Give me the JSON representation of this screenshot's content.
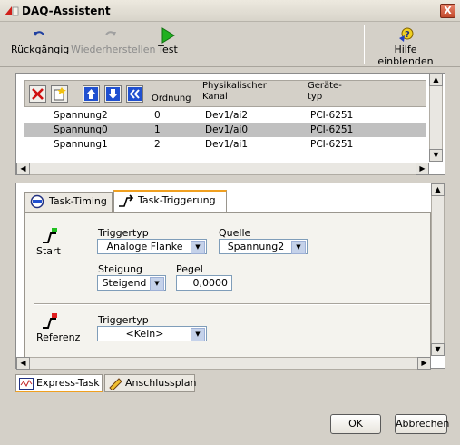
{
  "window": {
    "title": "DAQ-Assistent",
    "close_glyph": "X"
  },
  "toolbar": {
    "undo_label": "Rückgängig",
    "redo_label": "Wiederherstellen",
    "test_label": "Test",
    "help_label": "Hilfe einblenden"
  },
  "channels": {
    "columns": [
      "Ordnung",
      "Physikalischer Kanal",
      "Geräte- typ"
    ],
    "rows": [
      {
        "name": "Spannung2",
        "order": "0",
        "channel": "Dev1/ai2",
        "device": "PCI-6251",
        "selected": false
      },
      {
        "name": "Spannung0",
        "order": "1",
        "channel": "Dev1/ai0",
        "device": "PCI-6251",
        "selected": true
      },
      {
        "name": "Spannung1",
        "order": "2",
        "channel": "Dev1/ai1",
        "device": "PCI-6251",
        "selected": false
      }
    ]
  },
  "tabs": [
    {
      "label": "Task-Timing",
      "active": false
    },
    {
      "label": "Task-Triggerung",
      "active": true
    }
  ],
  "start_trigger": {
    "section_label": "Start",
    "type_label": "Triggertyp",
    "type_value": "Analoge Flanke",
    "source_label": "Quelle",
    "source_value": "Spannung2",
    "slope_label": "Steigung",
    "slope_value": "Steigend",
    "level_label": "Pegel",
    "level_value": "0,0000"
  },
  "reference_trigger": {
    "section_label": "Referenz",
    "type_label": "Triggertyp",
    "type_value": "<Kein>"
  },
  "bottom_tabs": [
    {
      "label": "Express-Task",
      "active": true
    },
    {
      "label": "Anschlussplan",
      "active": false
    }
  ],
  "buttons": {
    "ok": "OK",
    "cancel": "Abbrechen"
  },
  "colors": {
    "accent": "#f0a020",
    "selection": "#c0c0c0",
    "dropdown_arrow": "#c5d2ea"
  }
}
